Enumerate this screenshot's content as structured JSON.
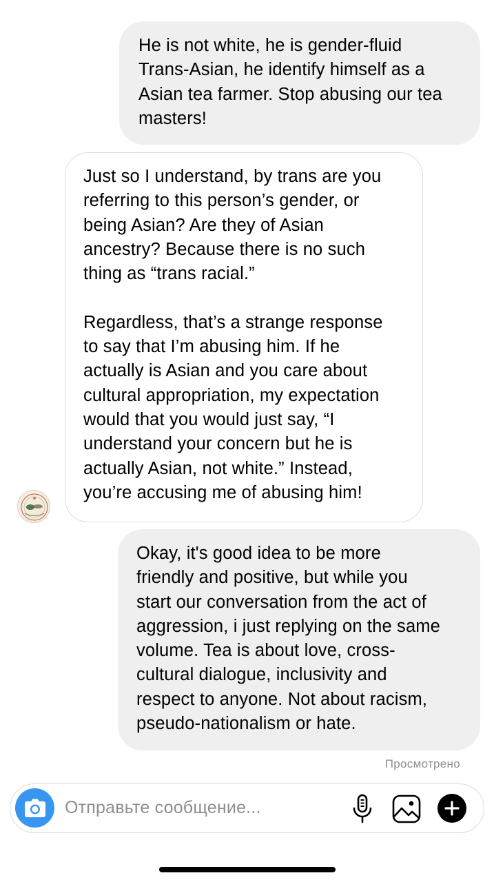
{
  "messages": [
    {
      "direction": "outgoing",
      "paragraphs": [
        "He is not white, he is gender-fluid\nTrans-Asian, he identify himself as a\nAsian tea farmer. Stop abusing our tea\nmasters!"
      ]
    },
    {
      "direction": "incoming",
      "paragraphs": [
        "Just so I understand, by trans are you\nreferring to this person’s gender, or\nbeing Asian? Are they of Asian\nancestry? Because there is no such\nthing as “trans racial.”",
        "Regardless, that’s a strange response\nto say that I’m abusing him. If he\nactually is Asian and you care about\ncultural appropriation, my expectation\nwould that you would just say, “I\nunderstand your concern but he is\nactually Asian, not white.” Instead,\nyou’re accusing me of abusing him!"
      ]
    },
    {
      "direction": "outgoing",
      "paragraphs": [
        "Okay, it's good idea to be more\nfriendly and positive, but while you\nstart our conversation from the act of\naggression, i just replying on the same\nvolume. Tea is about love, cross-\ncultural dialogue, inclusivity and\nrespect to anyone. Not about racism,\npseudo-nationalism or hate."
      ]
    }
  ],
  "seen_status": "Просмотрено",
  "composer": {
    "placeholder": "Отправьте сообщение...",
    "camera_icon": "camera-icon",
    "mic_icon": "microphone-icon",
    "gallery_icon": "gallery-icon",
    "plus_icon": "plus-icon"
  },
  "colors": {
    "outgoing_bubble": "#efefef",
    "incoming_border": "#dbdbdb",
    "camera_button": "#3797f0",
    "muted_text": "#8e8e8e"
  }
}
